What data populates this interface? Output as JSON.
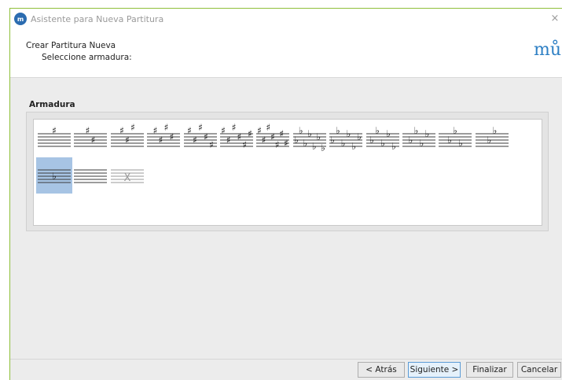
{
  "window": {
    "title": "Asistente para Nueva Partitura",
    "app_icon_text": "m",
    "close_glyph": "×"
  },
  "header": {
    "title": "Crear Partitura Nueva",
    "subtitle": "Seleccione armadura:",
    "logo_text": "mů"
  },
  "keys_group": {
    "label": "Armadura",
    "selected_index": 13,
    "keys": [
      {
        "accidental": "sharp",
        "count": 1
      },
      {
        "accidental": "sharp",
        "count": 2
      },
      {
        "accidental": "sharp",
        "count": 3
      },
      {
        "accidental": "sharp",
        "count": 4
      },
      {
        "accidental": "sharp",
        "count": 5
      },
      {
        "accidental": "sharp",
        "count": 6
      },
      {
        "accidental": "sharp",
        "count": 7
      },
      {
        "accidental": "flat",
        "count": 7
      },
      {
        "accidental": "flat",
        "count": 6
      },
      {
        "accidental": "flat",
        "count": 5
      },
      {
        "accidental": "flat",
        "count": 4
      },
      {
        "accidental": "flat",
        "count": 3
      },
      {
        "accidental": "flat",
        "count": 2
      },
      {
        "accidental": "flat",
        "count": 1
      },
      {
        "accidental": "none",
        "count": 0
      },
      {
        "accidental": "open",
        "count": 0
      }
    ]
  },
  "footer": {
    "back_label": "< Atrás",
    "next_label": "Siguiente >",
    "finish_label": "Finalizar",
    "cancel_label": "Cancelar"
  },
  "colors": {
    "window_border": "#8fbf3a",
    "selection": "#a7c4e4",
    "logo": "#2d7fc4"
  }
}
